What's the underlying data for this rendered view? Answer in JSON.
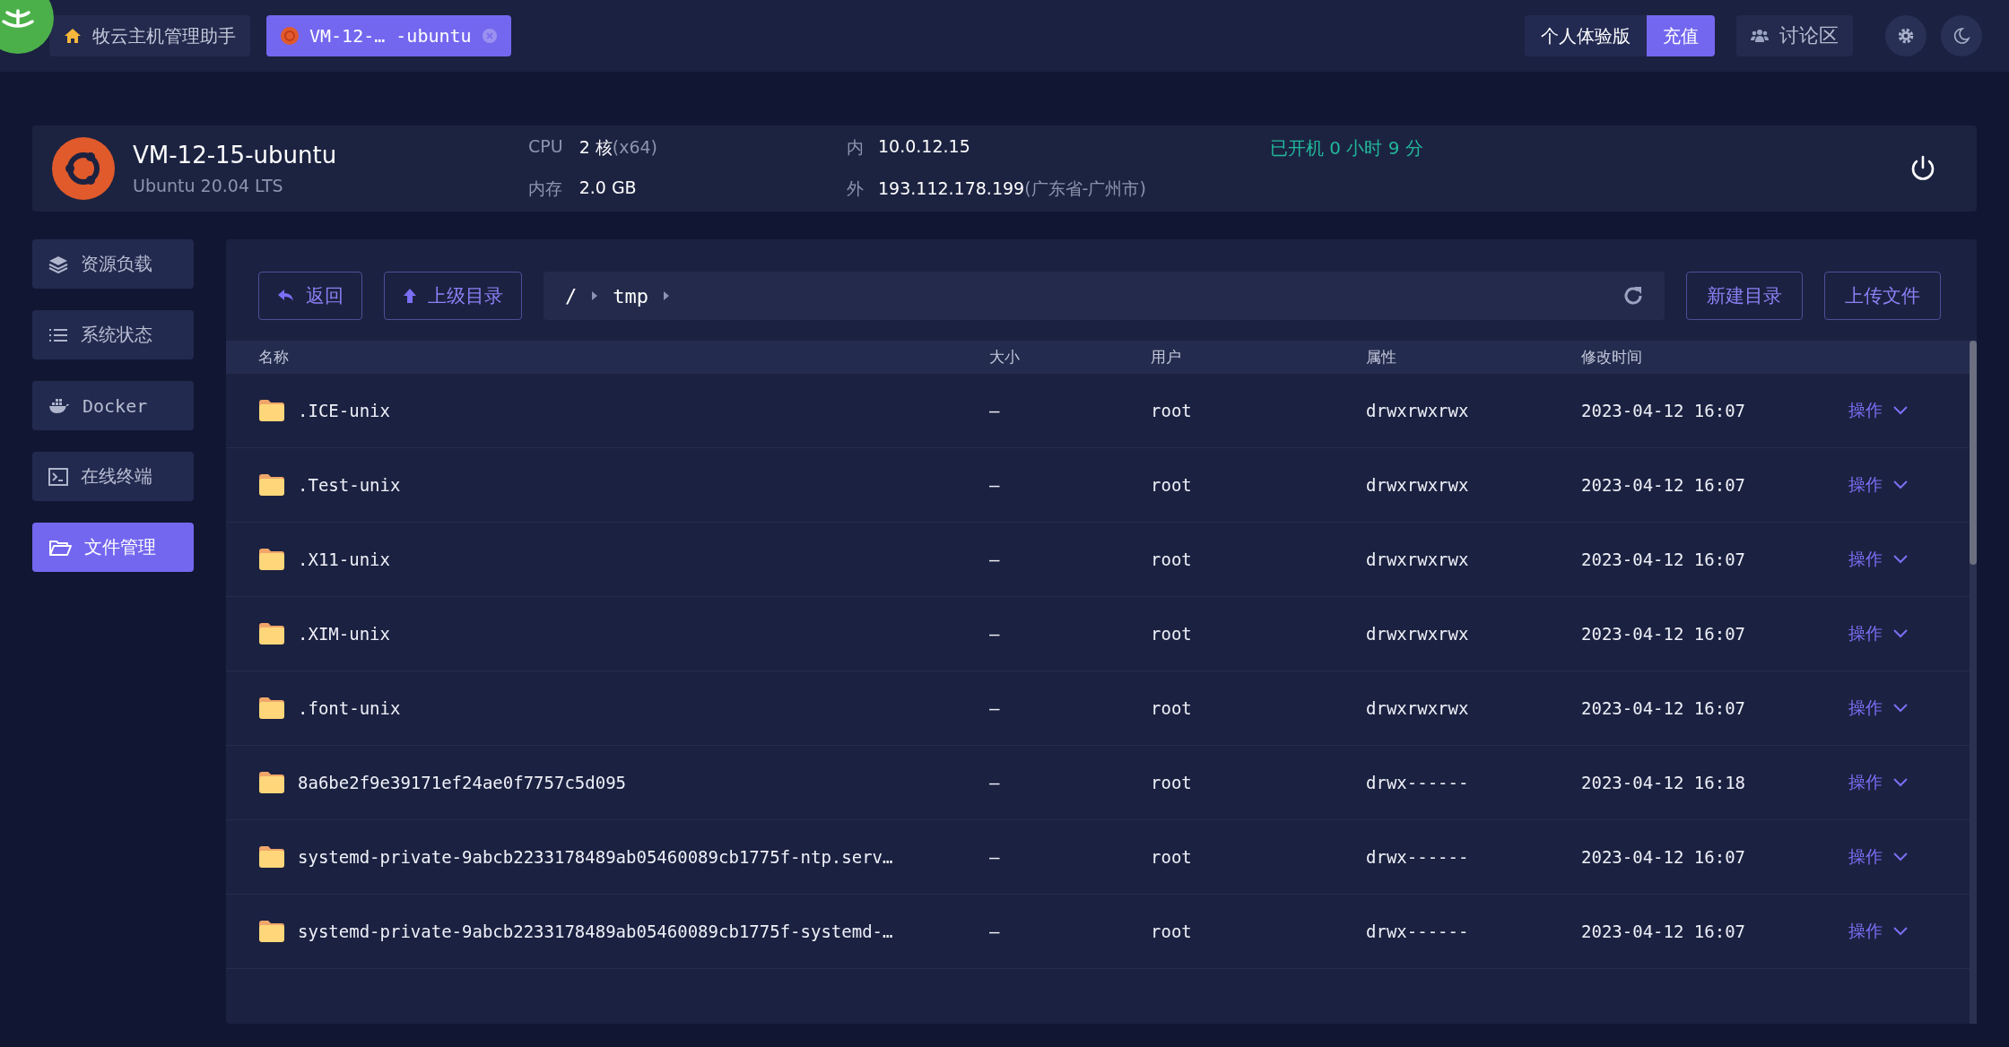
{
  "top_bar": {
    "tabs": [
      {
        "kind": "home",
        "label": "牧云主机管理助手",
        "selected": false
      },
      {
        "kind": "server",
        "label": "VM-12-… -ubuntu",
        "selected": true
      }
    ],
    "plan": {
      "label": "个人体验版",
      "action": "充值"
    },
    "forum": "讨论区"
  },
  "server": {
    "name": "VM-12-15-ubuntu",
    "os": "Ubuntu 20.04 LTS",
    "specs": [
      {
        "label": "CPU",
        "value": "2 核",
        "note": "(x64)"
      },
      {
        "label": "内存",
        "value": "2.0 GB"
      }
    ],
    "addresses": [
      {
        "label": "内",
        "value": "10.0.12.15"
      },
      {
        "label": "外",
        "value": "193.112.178.199",
        "note": "(广东省-广州市)"
      }
    ],
    "uptime": "已开机 0 小时 9 分"
  },
  "sidebar": {
    "items": [
      {
        "kind": "layers",
        "label": "资源负载",
        "selected": false
      },
      {
        "kind": "list",
        "label": "系统状态",
        "selected": false
      },
      {
        "kind": "docker",
        "label": "Docker",
        "selected": false
      },
      {
        "kind": "terminal",
        "label": "在线终端",
        "selected": false
      },
      {
        "kind": "folder",
        "label": "文件管理",
        "selected": true
      }
    ]
  },
  "toolbar": {
    "back": "返回",
    "up": "上级目录",
    "path": [
      "/",
      "tmp"
    ],
    "new_folder": "新建目录",
    "upload": "上传文件"
  },
  "table": {
    "columns": [
      "名称",
      "大小",
      "用户",
      "属性",
      "修改时间"
    ],
    "rows": [
      {
        "name": ".ICE-unix",
        "size": "–",
        "user": "root",
        "mode": "drwxrwxrwx",
        "modified": "2023-04-12 16:07",
        "action": "操作"
      },
      {
        "name": ".Test-unix",
        "size": "–",
        "user": "root",
        "mode": "drwxrwxrwx",
        "modified": "2023-04-12 16:07",
        "action": "操作"
      },
      {
        "name": ".X11-unix",
        "size": "–",
        "user": "root",
        "mode": "drwxrwxrwx",
        "modified": "2023-04-12 16:07",
        "action": "操作"
      },
      {
        "name": ".XIM-unix",
        "size": "–",
        "user": "root",
        "mode": "drwxrwxrwx",
        "modified": "2023-04-12 16:07",
        "action": "操作"
      },
      {
        "name": ".font-unix",
        "size": "–",
        "user": "root",
        "mode": "drwxrwxrwx",
        "modified": "2023-04-12 16:07",
        "action": "操作"
      },
      {
        "name": "8a6be2f9e39171ef24ae0f7757c5d095",
        "size": "–",
        "user": "root",
        "mode": "drwx------",
        "modified": "2023-04-12 16:18",
        "action": "操作"
      },
      {
        "name": "systemd-private-9abcb2233178489ab05460089cb1775f-ntp.serv…",
        "size": "–",
        "user": "root",
        "mode": "drwx------",
        "modified": "2023-04-12 16:07",
        "action": "操作"
      },
      {
        "name": "systemd-private-9abcb2233178489ab05460089cb1775f-systemd-…",
        "size": "–",
        "user": "root",
        "mode": "drwx------",
        "modified": "2023-04-12 16:07",
        "action": "操作"
      }
    ]
  }
}
